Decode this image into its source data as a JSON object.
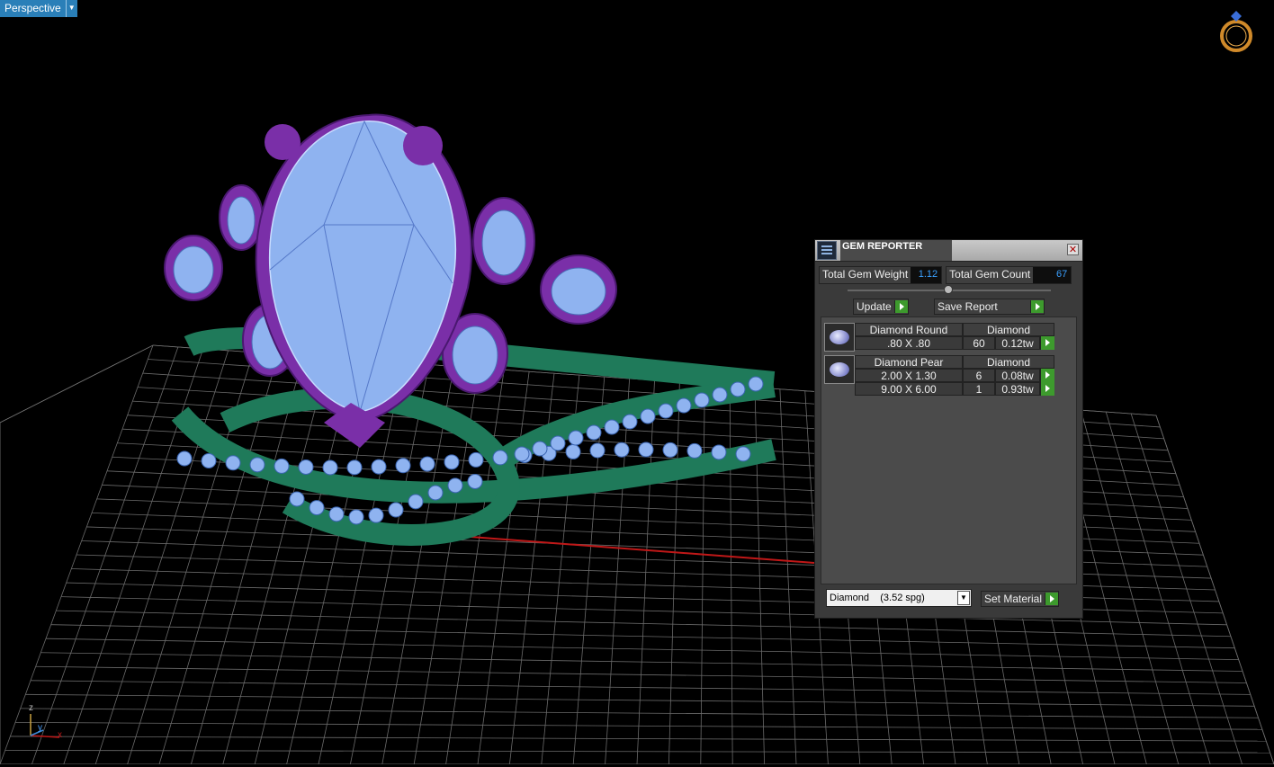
{
  "viewport": {
    "label": "Perspective",
    "axis": {
      "z": "z",
      "y": "y",
      "x": "x"
    }
  },
  "panel": {
    "title": "GEM REPORTER",
    "stats": [
      {
        "label": "Total Gem Weight",
        "value": "1.12"
      },
      {
        "label": "Total Gem Count",
        "value": "67"
      }
    ],
    "buttons": {
      "update": "Update",
      "save_report": "Save Report"
    },
    "gems": [
      {
        "name": "Diamond Round",
        "material": "Diamond",
        "rows": [
          {
            "size": ".80 X .80",
            "count": "60",
            "weight": "0.12tw"
          }
        ]
      },
      {
        "name": "Diamond Pear",
        "material": "Diamond",
        "rows": [
          {
            "size": "2.00 X 1.30",
            "count": "6",
            "weight": "0.08tw"
          },
          {
            "size": "9.00 X 6.00",
            "count": "1",
            "weight": "0.93tw"
          }
        ]
      }
    ],
    "material_select": "Diamond    (3.52 spg)",
    "set_material": "Set Material"
  },
  "colors": {
    "metal": "#7a2fa8",
    "band": "#1f7a5a",
    "gem": "#8fb3f0",
    "accent": "#3d9a2d",
    "value_text": "#3aa0ff"
  }
}
